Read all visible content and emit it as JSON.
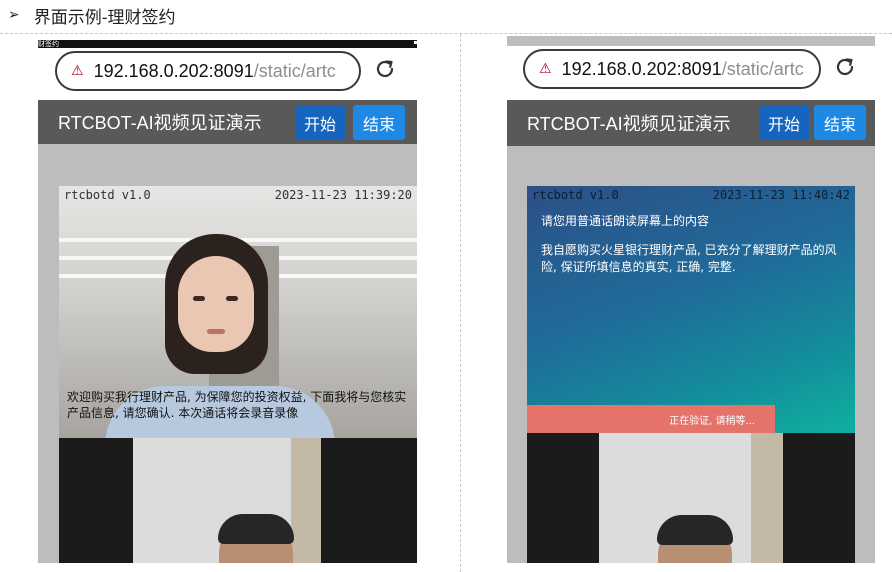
{
  "doc": {
    "bullet": "➢",
    "heading": "界面示例-理财签约"
  },
  "left_phone": {
    "status_label": "财签约",
    "url_host": "192.168.0.202:8091",
    "url_path": "/static/artc",
    "app_title": "RTCBOT-AI视频见证演示",
    "start_label": "开始",
    "end_label": "结束",
    "video_brand": "rtcbotd v1.0",
    "video_timestamp": "2023-11-23 11:39:20",
    "caption": "欢迎购买我行理财产品, 为保障您的投资权益, 下面我将与您核实产品信息, 请您确认. 本次通话将会录音录像"
  },
  "right_phone": {
    "url_host": "192.168.0.202:8091",
    "url_path": "/static/artc",
    "app_title": "RTCBOT-AI视频见证演示",
    "start_label": "开始",
    "end_label": "结束",
    "video_brand": "rtcbotd v1.0",
    "video_timestamp": "2023-11-23 11:40:42",
    "prompt": "请您用普通话朗读屏幕上的内容",
    "statement": "我自愿购买火星银行理财产品, 已充分了解理财产品的风险, 保证所填信息的真实, 正确, 完整.",
    "verifying": "正在验证, 请稍等..."
  },
  "icons": {
    "warning": "warning-triangle-icon",
    "reload": "reload-icon"
  },
  "colors": {
    "header_bg": "#595959",
    "start_button": "#1565c0",
    "end_button": "#1e88e5",
    "verify_bar": "#e57369"
  }
}
